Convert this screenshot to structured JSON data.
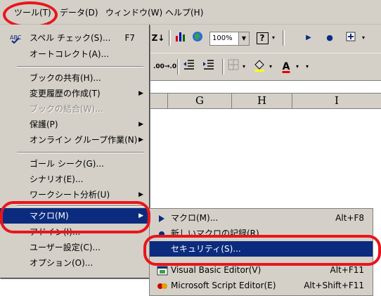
{
  "menubar": {
    "items": [
      {
        "label": "ツール(T)"
      },
      {
        "label": "データ(D)"
      },
      {
        "label": "ウィンドウ(W)"
      },
      {
        "label": "ヘルプ(H)"
      }
    ]
  },
  "toolbar1": {
    "zoom": "100%",
    "help_glyph": "?",
    "sort_label": "Z↓",
    "chart_icon": "chart-wizard-icon",
    "map_icon": "map-icon"
  },
  "toolbar2": {
    "decrease_decimal": ".00→.0",
    "font_color_letter": "A"
  },
  "columns": [
    "G",
    "H",
    "I"
  ],
  "tools_menu": {
    "items": [
      {
        "label": "スペル チェック(S)...",
        "shortcut": "F7",
        "icon": "spell-check-icon"
      },
      {
        "label": "オートコレクト(A)..."
      },
      {
        "label": "ブックの共有(H)..."
      },
      {
        "label": "変更履歴の作成(T)",
        "submenu": "▶"
      },
      {
        "label": "ブックの結合(W)...",
        "disabled": true
      },
      {
        "label": "保護(P)",
        "submenu": "▶"
      },
      {
        "label": "オンライン グループ作業(N)",
        "submenu": "▶"
      },
      {
        "label": "ゴール シーク(G)..."
      },
      {
        "label": "シナリオ(E)..."
      },
      {
        "label": "ワークシート分析(U)",
        "submenu": "▶"
      },
      {
        "label": "マクロ(M)",
        "submenu": "▶",
        "active": true
      },
      {
        "label": "アドイン(I)..."
      },
      {
        "label": "ユーザー設定(C)..."
      },
      {
        "label": "オプション(O)..."
      }
    ]
  },
  "macro_submenu": {
    "items": [
      {
        "label": "マクロ(M)...",
        "shortcut": "Alt+F8",
        "icon": "play-macro-icon"
      },
      {
        "label": "新しいマクロの記録(R)...",
        "icon": "record-macro-icon"
      },
      {
        "label": "セキュリティ(S)...",
        "active": true
      },
      {
        "label": "Visual Basic Editor(V)",
        "shortcut": "Alt+F11",
        "icon": "vb-editor-icon"
      },
      {
        "label": "Microsoft Script Editor(E)",
        "shortcut": "Alt+Shift+F11",
        "icon": "script-editor-icon"
      }
    ]
  },
  "colors": {
    "menu_bg": "#d4d0c8",
    "highlight": "#0b2c7e",
    "annotation_red": "#e8161b"
  }
}
